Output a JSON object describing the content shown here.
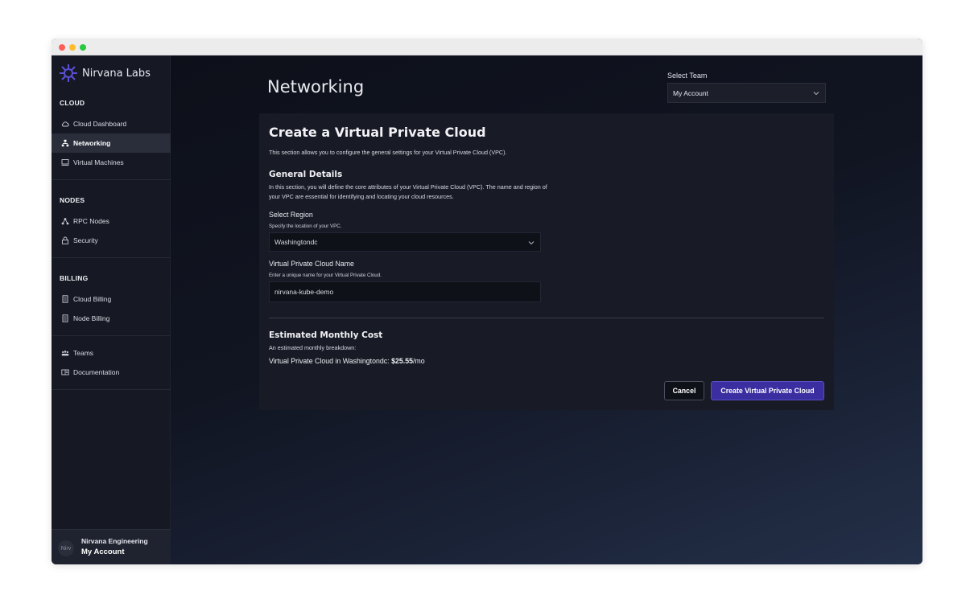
{
  "app": {
    "brand_name": "Nirvana Labs",
    "logo_icon": "nirvana-logo-icon",
    "accent_color": "#3a2ea0"
  },
  "sidebar": {
    "sections": [
      {
        "title": "CLOUD",
        "items": [
          {
            "label": "Cloud Dashboard",
            "icon": "cloud-icon",
            "active": false
          },
          {
            "label": "Networking",
            "icon": "network-icon",
            "active": true
          },
          {
            "label": "Virtual Machines",
            "icon": "monitor-icon",
            "active": false
          }
        ]
      },
      {
        "title": "NODES",
        "items": [
          {
            "label": "RPC Nodes",
            "icon": "nodes-icon",
            "active": false
          },
          {
            "label": "Security",
            "icon": "lock-icon",
            "active": false
          }
        ]
      },
      {
        "title": "BILLING",
        "items": [
          {
            "label": "Cloud Billing",
            "icon": "receipt-icon",
            "active": false
          },
          {
            "label": "Node Billing",
            "icon": "receipt-icon",
            "active": false
          }
        ]
      },
      {
        "title": "",
        "items": [
          {
            "label": "Teams",
            "icon": "team-icon",
            "active": false
          },
          {
            "label": "Documentation",
            "icon": "book-icon",
            "active": false
          }
        ]
      }
    ],
    "account": {
      "avatar_alt": "Nirv",
      "org": "Nirvana Engineering",
      "name": "My Account"
    }
  },
  "header": {
    "page_title": "Networking",
    "team_label": "Select Team",
    "team_value": "My Account"
  },
  "form": {
    "title": "Create a Virtual Private Cloud",
    "description": "This section allows you to configure the general settings for your Virtual Private Cloud (VPC).",
    "general": {
      "title": "General Details",
      "description": "In this section, you will define the core attributes of your Virtual Private Cloud (VPC). The name and region of your VPC are essential for identifying and locating your cloud resources."
    },
    "region": {
      "label": "Select Region",
      "help": "Specify the location of your VPC.",
      "value": "Washingtondc"
    },
    "name": {
      "label": "Virtual Private Cloud Name",
      "help": "Enter a unique name for your Virtual Private Cloud.",
      "value": "nirvana-kube-demo"
    },
    "cost": {
      "title": "Estimated Monthly Cost",
      "subtitle": "An estimated monthly breakdown:",
      "line_prefix": "Virtual Private Cloud in Washingtondc: ",
      "amount": "$25.55",
      "suffix": "/mo"
    },
    "buttons": {
      "cancel": "Cancel",
      "create": "Create Virtual Private Cloud"
    }
  }
}
